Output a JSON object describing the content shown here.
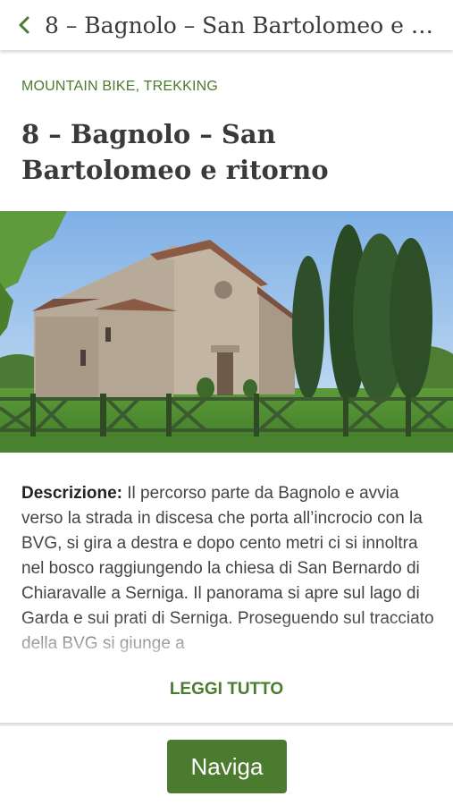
{
  "header": {
    "title": "8 – Bagnolo – San Bartolomeo e ritorno"
  },
  "route": {
    "category": "MOUNTAIN BIKE, TREKKING",
    "title": "8 – Bagnolo – San Bartolomeo e ritorno",
    "description_label": "Descrizione",
    "description_text": "Il percorso parte da Bagnolo e avvia verso la strada in discesa che porta all’incrocio con la BVG, si gira a destra e dopo cento metri ci si innoltra nel bosco raggiungendo la chiesa di San Bernardo di Chiaravalle a Serniga. Il panorama si apre sul lago di Garda e sui prati di Serniga. Proseguendo sul tracciato della BVG si giunge a",
    "read_more": "LEGGI TUTTO"
  },
  "actions": {
    "navigate": "Naviga"
  },
  "colors": {
    "accent": "#4a7b2e",
    "title_text": "#3a3a3a"
  },
  "icons": {
    "back": "chevron-left-icon"
  }
}
